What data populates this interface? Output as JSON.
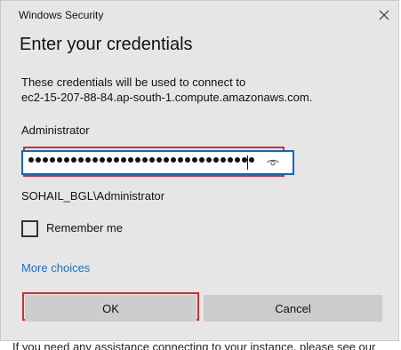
{
  "window": {
    "title": "Windows Security"
  },
  "dialog": {
    "heading": "Enter your credentials",
    "description_line1": "These credentials will be used to connect to",
    "description_line2": "ec2-15-207-88-84.ap-south-1.compute.amazonaws.com."
  },
  "credentials": {
    "username": "Administrator",
    "password_masked": "●●●●●●●●●●●●●●●●●●●●●●●●●●●●●●●●",
    "domain_user": "SOHAIL_BGL\\Administrator"
  },
  "remember": {
    "label": "Remember me",
    "checked": false
  },
  "links": {
    "more_choices": "More choices"
  },
  "buttons": {
    "ok": "OK",
    "cancel": "Cancel"
  },
  "background": {
    "text": "If you need any assistance connecting to your instance, please see our"
  },
  "colors": {
    "accent": "#0a66c8",
    "highlight": "#d82b2b",
    "link": "#1a6fc8",
    "dialog_bg": "#e6e6e6"
  }
}
